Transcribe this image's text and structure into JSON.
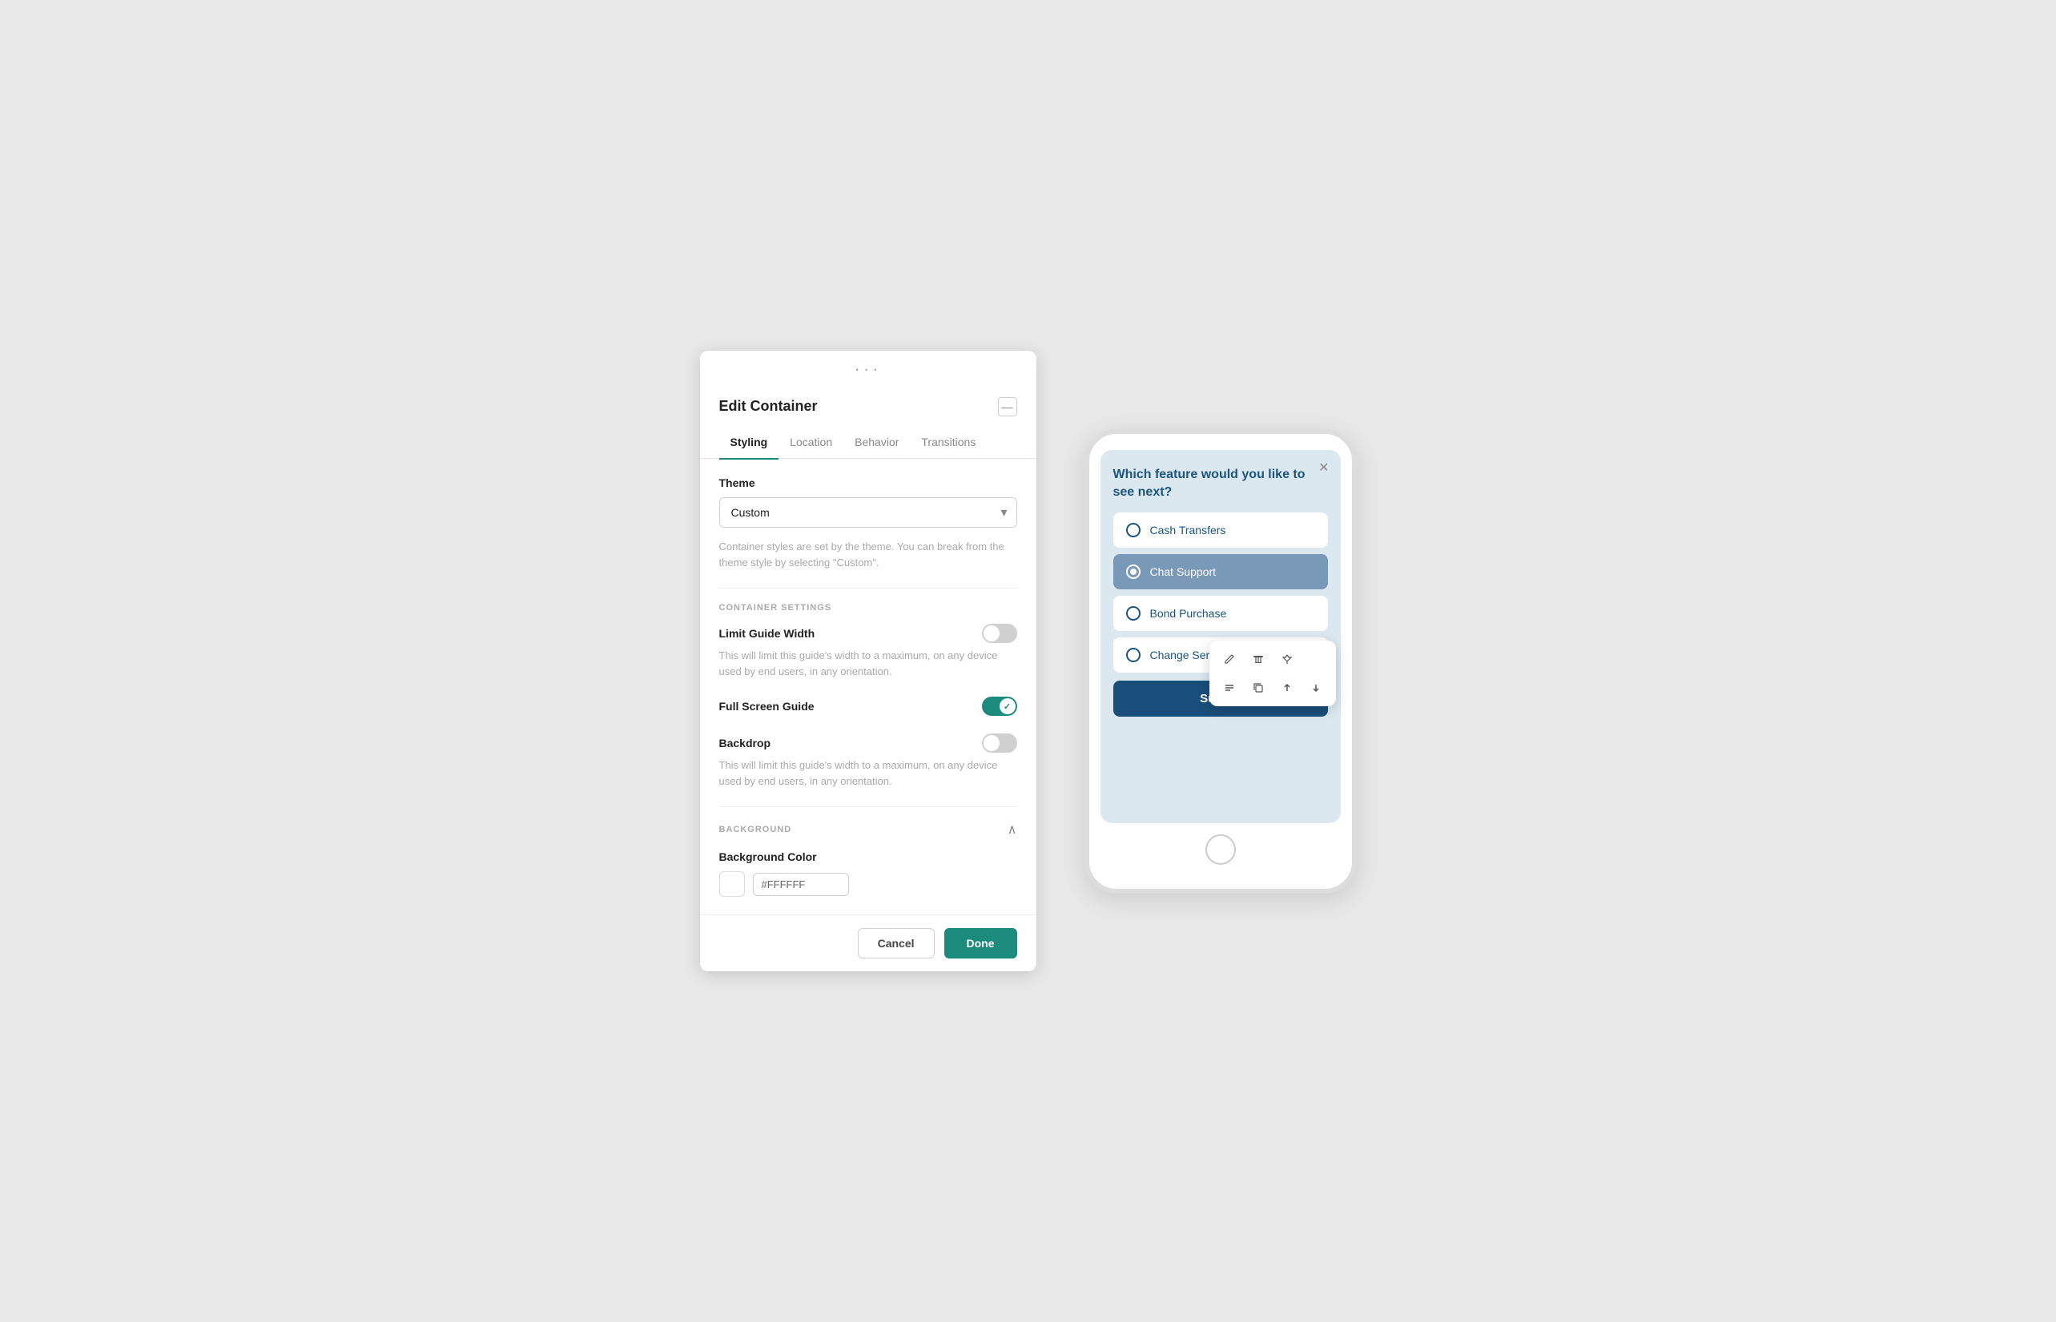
{
  "panel": {
    "dots": "···",
    "title": "Edit Container",
    "minimize_icon": "—",
    "tabs": [
      {
        "label": "Styling",
        "active": true
      },
      {
        "label": "Location",
        "active": false
      },
      {
        "label": "Behavior",
        "active": false
      },
      {
        "label": "Transitions",
        "active": false
      }
    ],
    "theme_section": {
      "label": "Theme",
      "dropdown_value": "Custom",
      "hint": "Container styles are set by the theme. You can break from the theme style by selecting \"Custom\"."
    },
    "container_settings": {
      "section_label": "CONTAINER SETTINGS",
      "limit_guide_width": {
        "title": "Limit Guide Width",
        "enabled": false,
        "hint": "This will limit this guide's width to a maximum, on any device used by end users, in any orientation."
      },
      "full_screen_guide": {
        "title": "Full Screen Guide",
        "enabled": true
      },
      "backdrop": {
        "title": "Backdrop",
        "enabled": false,
        "hint": "This will limit this guide's width to a maximum, on any device used by end users, in any orientation."
      }
    },
    "background_section": {
      "section_label": "BACKGROUND",
      "color_label": "Background Color",
      "color_value": "#FFFFFF",
      "color_hex_display": "#FFFFFF"
    },
    "footer": {
      "cancel_label": "Cancel",
      "done_label": "Done"
    }
  },
  "phone": {
    "question": "Which feature would you like to see next?",
    "options": [
      {
        "label": "Cash Transfers",
        "selected": false
      },
      {
        "label": "Chat Support",
        "selected": true
      },
      {
        "label": "Bond Purchase",
        "selected": false
      },
      {
        "label": "Change Service",
        "selected": false
      }
    ],
    "submit_label": "Submit",
    "toolbar": {
      "btn_edit": "✎",
      "btn_delete": "🗑",
      "btn_pin": "📌",
      "btn_align": "≡",
      "btn_copy": "⧉",
      "btn_up": "↑",
      "btn_down": "↓"
    }
  }
}
